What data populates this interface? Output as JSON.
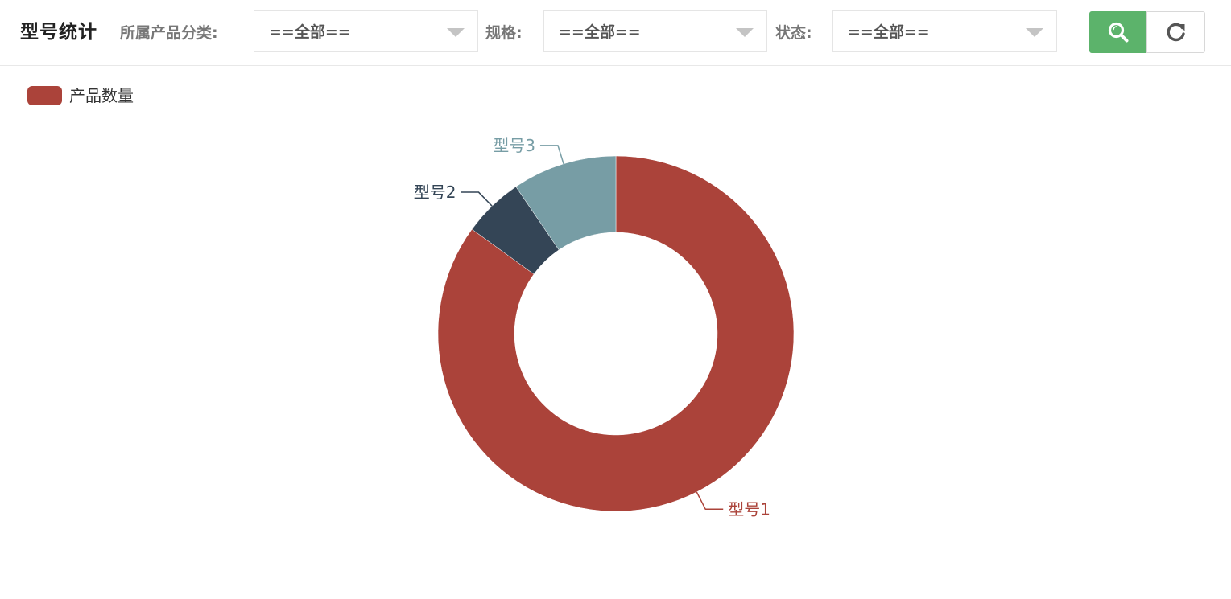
{
  "header": {
    "title": "型号统计",
    "filters": [
      {
        "label": "所属产品分类:",
        "value": "==全部=="
      },
      {
        "label": "规格:",
        "value": "==全部=="
      },
      {
        "label": "状态:",
        "value": "==全部=="
      }
    ],
    "search_icon": "search-icon",
    "reset_icon": "refresh-icon",
    "search_color": "#5cb36b"
  },
  "chart_data": {
    "type": "pie",
    "donut": true,
    "legend": [
      "产品数量"
    ],
    "legend_placement": "top-left",
    "series": [
      {
        "name": "产品数量",
        "slices": [
          {
            "label": "型号1",
            "value": 85,
            "color": "#ab433a"
          },
          {
            "label": "型号2",
            "value": 5.5,
            "color": "#344556"
          },
          {
            "label": "型号3",
            "value": 9.5,
            "color": "#779da5"
          }
        ]
      }
    ]
  }
}
